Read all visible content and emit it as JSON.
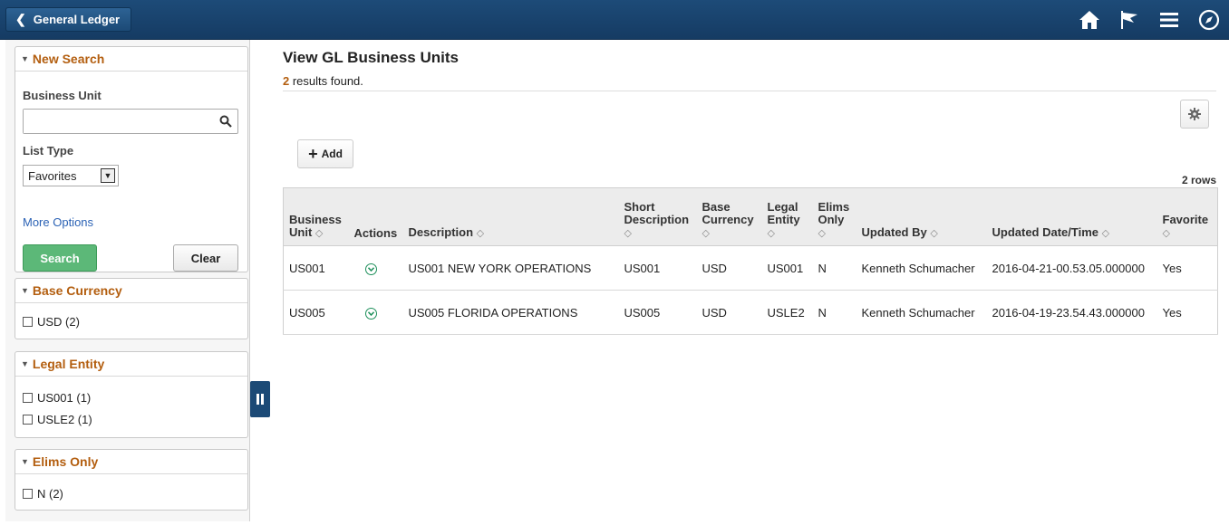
{
  "banner": {
    "back_label": "General Ledger"
  },
  "left": {
    "new_search": {
      "title": "New Search",
      "business_unit_label": "Business Unit",
      "business_unit_value": "",
      "list_type_label": "List Type",
      "list_type_value": "Favorites",
      "more_options": "More Options",
      "search_label": "Search",
      "clear_label": "Clear"
    },
    "base_currency": {
      "title": "Base Currency",
      "items": [
        "USD (2)"
      ]
    },
    "legal_entity": {
      "title": "Legal Entity",
      "items": [
        "US001 (1)",
        "USLE2 (1)"
      ]
    },
    "elims_only": {
      "title": "Elims Only",
      "items": [
        "N (2)"
      ]
    }
  },
  "main": {
    "title": "View GL Business Units",
    "results_count": "2",
    "results_text": " results found.",
    "add_label": "Add",
    "rows_label": "2 rows",
    "columns": [
      [
        "Business",
        "Unit"
      ],
      [
        "Actions"
      ],
      [
        "Description"
      ],
      [
        "Short",
        "Description"
      ],
      [
        "Base",
        "Currency"
      ],
      [
        "Legal",
        "Entity"
      ],
      [
        "Elims",
        "Only"
      ],
      [
        "Updated By"
      ],
      [
        "Updated Date/Time"
      ],
      [
        "Favorite"
      ]
    ],
    "rows": [
      [
        "US001",
        "",
        "US001 NEW YORK OPERATIONS",
        "US001",
        "USD",
        "US001",
        "N",
        "Kenneth Schumacher",
        "2016-04-21-00.53.05.000000",
        "Yes"
      ],
      [
        "US005",
        "",
        "US005 FLORIDA OPERATIONS",
        "US005",
        "USD",
        "USLE2",
        "N",
        "Kenneth Schumacher",
        "2016-04-19-23.54.43.000000",
        "Yes"
      ]
    ]
  },
  "colors": {
    "banner": "#1d4b78",
    "accent_orange": "#b35e0f",
    "search_green": "#5cb878",
    "link_blue": "#2b62b5"
  }
}
